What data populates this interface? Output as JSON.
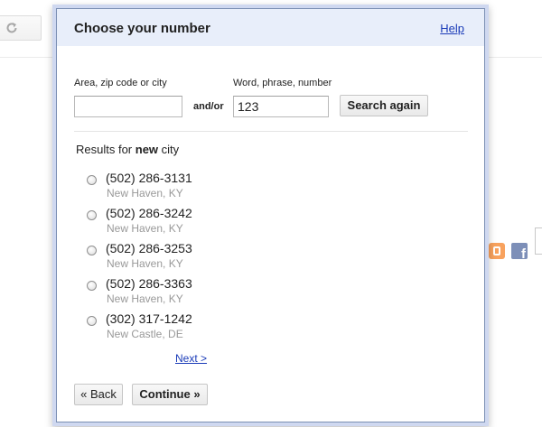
{
  "background": {
    "refresh_icon": "refresh-icon",
    "social_icons": [
      "blogger-icon",
      "facebook-icon"
    ],
    "facebook_glyph": "f"
  },
  "dialog": {
    "title": "Choose your number",
    "help_link": "Help",
    "search": {
      "area_label": "Area, zip code or city",
      "area_value": "",
      "andor_label": "and/or",
      "word_label": "Word, phrase, number",
      "word_value": "123",
      "search_button": "Search again"
    },
    "results": {
      "prefix": "Results for ",
      "query": "new",
      "suffix": " city",
      "items": [
        {
          "number": "(502) 286-3131",
          "location": "New Haven, KY"
        },
        {
          "number": "(502) 286-3242",
          "location": "New Haven, KY"
        },
        {
          "number": "(502) 286-3253",
          "location": "New Haven, KY"
        },
        {
          "number": "(502) 286-3363",
          "location": "New Haven, KY"
        },
        {
          "number": "(302) 317-1242",
          "location": "New Castle, DE"
        }
      ],
      "next_link": "Next >"
    },
    "footer": {
      "back_button": "« Back",
      "continue_button": "Continue »"
    }
  }
}
